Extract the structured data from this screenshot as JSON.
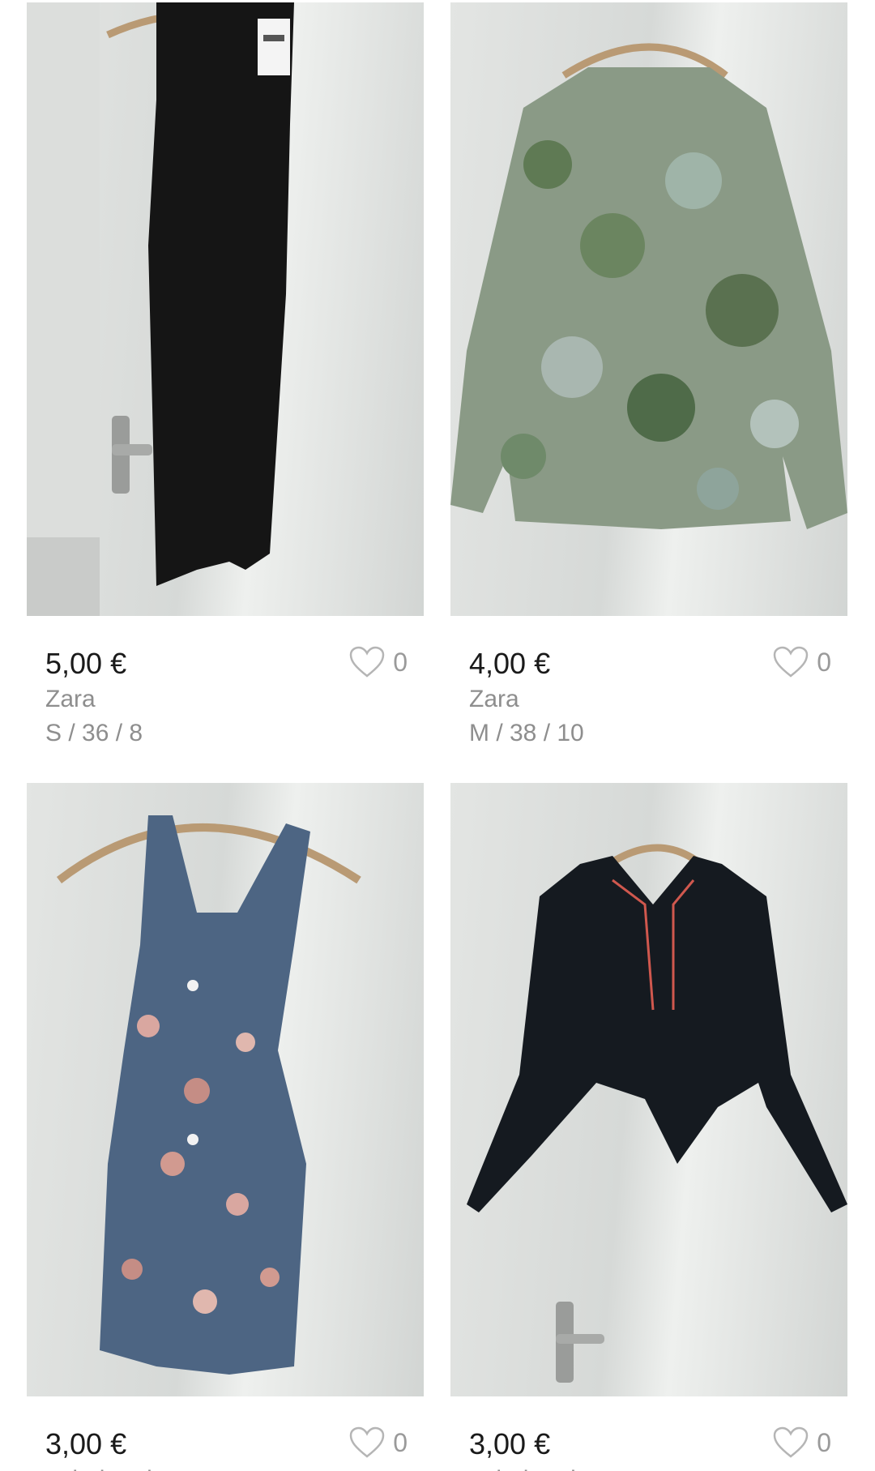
{
  "items": [
    {
      "price": "5,00 €",
      "brand": "Zara",
      "size": "S / 36 / 8",
      "favorites": "0",
      "garment": "black-dress"
    },
    {
      "price": "4,00 €",
      "brand": "Zara",
      "size": "M / 38 / 10",
      "favorites": "0",
      "garment": "floral-blouse"
    },
    {
      "price": "3,00 €",
      "brand": "onbekend",
      "size": "",
      "favorites": "0",
      "garment": "floral-playsuit"
    },
    {
      "price": "3,00 €",
      "brand": "onbekend",
      "size": "",
      "favorites": "0",
      "garment": "black-blazer"
    }
  ],
  "colors": {
    "price": "#1a1a1a",
    "secondary_text": "#8e8e8e",
    "heart_outline": "#b5b5b5",
    "background": "#ffffff"
  }
}
